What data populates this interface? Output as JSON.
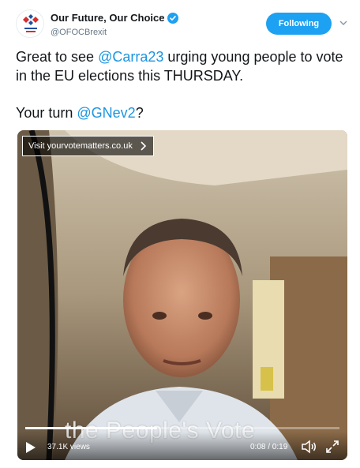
{
  "account": {
    "display_name": "Our Future, Our Choice",
    "handle": "@OFOCBrexit",
    "verified": true,
    "follow_label": "Following",
    "avatar_icon": "ofoc-logo-icon"
  },
  "tweet": {
    "line1_pre": "Great to see ",
    "line1_mention": "@Carra23",
    "line1_post": " urging young people to vote in the EU elections this THURSDAY.",
    "line2_pre": "Your turn ",
    "line2_mention": "@GNev2",
    "line2_post": "?"
  },
  "video": {
    "cta_label": "Visit yourvotematters.co.uk",
    "overlay_text": "the People's Vote",
    "views": "37.1K views",
    "time": "0:08 / 0:19",
    "progress": 0.42
  },
  "colors": {
    "accent": "#1da1f2",
    "mention": "#1b95e0",
    "text": "#14171a",
    "muted": "#657786"
  }
}
